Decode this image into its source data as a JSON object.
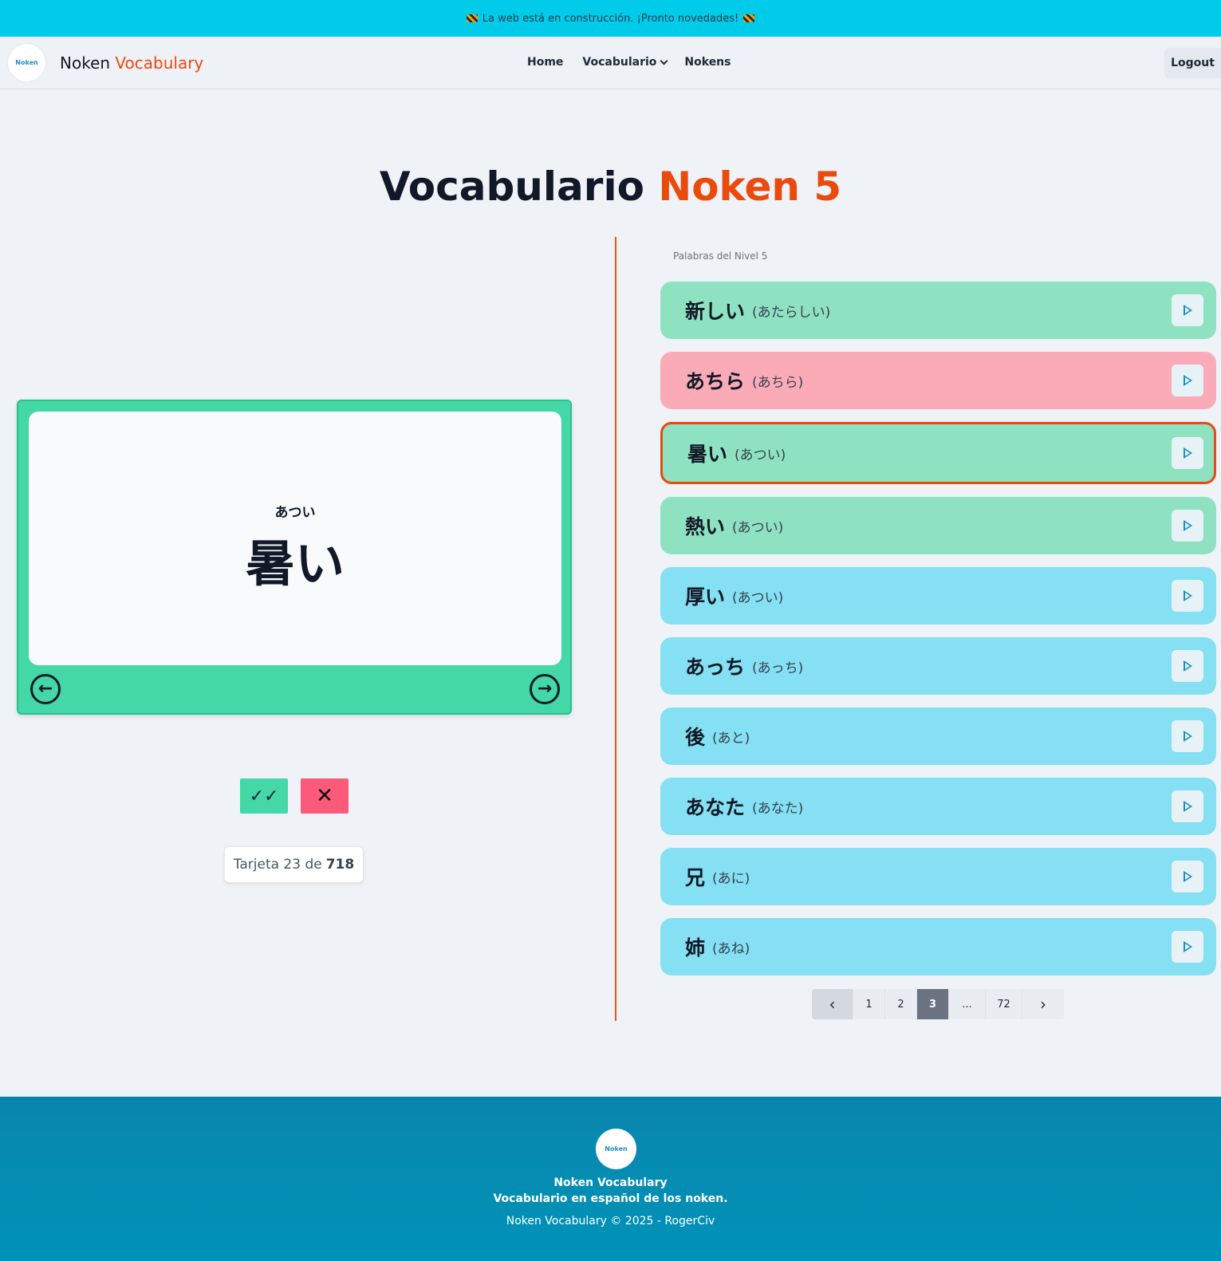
{
  "banner": {
    "text": "La web está en construcción. ¡Pronto novedades!"
  },
  "nav": {
    "logo_text": "Noken",
    "brand_main": "Noken",
    "brand_accent": "Vocabulary",
    "links": [
      "Home",
      "Vocabulario",
      "Nokens"
    ],
    "logout": "Logout"
  },
  "title": {
    "main": "Vocabulario",
    "accent": "Noken 5"
  },
  "flashcard": {
    "reading": "あつい",
    "word": "暑い",
    "prev_icon": "←",
    "next_icon": "→",
    "check_icon": "✓✓",
    "x_icon": "✕"
  },
  "counter": {
    "prefix": "Tarjeta 23 de",
    "total": "718"
  },
  "list": {
    "label": "Palabras del Nivel 5",
    "items": [
      {
        "kanji": "新しい",
        "kana": "(あたらしい)",
        "status": "green"
      },
      {
        "kanji": "あちら",
        "kana": "(あちら)",
        "status": "pink"
      },
      {
        "kanji": "暑い",
        "kana": "(あつい)",
        "status": "green-selected"
      },
      {
        "kanji": "熱い",
        "kana": "(あつい)",
        "status": "green"
      },
      {
        "kanji": "厚い",
        "kana": "(あつい)",
        "status": "blue"
      },
      {
        "kanji": "あっち",
        "kana": "(あっち)",
        "status": "blue"
      },
      {
        "kanji": "後",
        "kana": "(あと)",
        "status": "blue"
      },
      {
        "kanji": "あなた",
        "kana": "(あなた)",
        "status": "blue"
      },
      {
        "kanji": "兄",
        "kana": "(あに)",
        "status": "blue"
      },
      {
        "kanji": "姉",
        "kana": "(あね)",
        "status": "blue"
      }
    ]
  },
  "pagination": {
    "prev": "‹",
    "pages": [
      "1",
      "2",
      "3",
      "...",
      "72"
    ],
    "current": "3",
    "next": "›"
  },
  "footer": {
    "logo_text": "Noken",
    "name": "Noken Vocabulary",
    "tagline": "Vocabulario en español de los noken.",
    "copyright": "Noken Vocabulary © 2025 - RogerCiv"
  },
  "colors": {
    "accent": "#ea4a0c",
    "banner": "#00cbe8",
    "card_green": "#43d8a5",
    "row_green": "#8ee2c1",
    "row_pink": "#fbabb8",
    "row_blue": "#84e0f2",
    "footer": "#0092b8"
  }
}
